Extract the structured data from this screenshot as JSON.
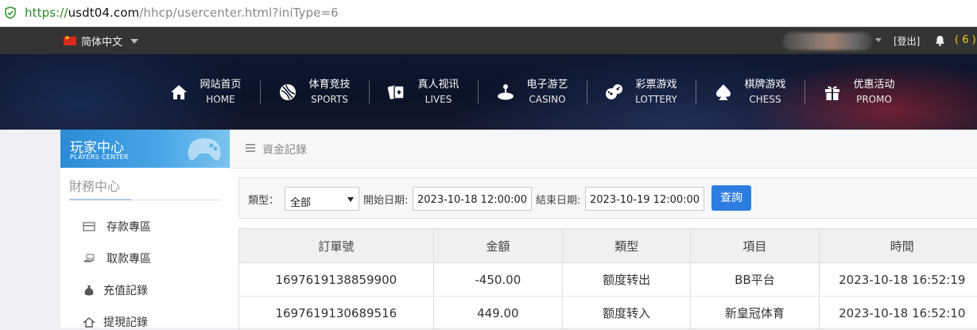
{
  "address_bar": {
    "scheme": "https://",
    "domain": "usdt04.com",
    "path": "/hhcp/usercenter.html?iniType=6"
  },
  "topbar": {
    "language": "简体中文",
    "logout": "[登出]",
    "notice_count": "( 6 )"
  },
  "nav": [
    {
      "cn": "网站首页",
      "en": "HOME",
      "icon": "home-icon"
    },
    {
      "cn": "体育竞技",
      "en": "SPORTS",
      "icon": "ball-icon"
    },
    {
      "cn": "真人视讯",
      "en": "LIVES",
      "icon": "cards-icon"
    },
    {
      "cn": "电子游艺",
      "en": "CASINO",
      "icon": "joystick-icon"
    },
    {
      "cn": "彩票游戏",
      "en": "LOTTERY",
      "icon": "dice-icon"
    },
    {
      "cn": "棋牌游戏",
      "en": "CHESS",
      "icon": "spade-icon"
    },
    {
      "cn": "优惠活动",
      "en": "PROMO",
      "icon": "gift-icon"
    }
  ],
  "sidebar": {
    "header_cn": "玩家中心",
    "header_en": "PLAYERS CENTER",
    "section_title": "財務中心",
    "items": [
      {
        "label": "存款專區",
        "icon": "deposit-card-icon"
      },
      {
        "label": "取款專區",
        "icon": "withdraw-hand-icon"
      },
      {
        "label": "充值記錄",
        "icon": "money-bag-icon"
      },
      {
        "label": "提現記錄",
        "icon": "withdraw-record-icon"
      }
    ]
  },
  "content": {
    "breadcrumb": "資金記錄",
    "filter": {
      "type_label": "類型：",
      "type_value": "全部",
      "start_label": "開始日期:",
      "start_value": "2023-10-18 12:00:00",
      "end_label": "結束日期:",
      "end_value": "2023-10-19 12:00:00",
      "query_button": "查詢"
    },
    "table": {
      "headers": [
        "訂單號",
        "金額",
        "類型",
        "項目",
        "時間"
      ],
      "rows": [
        [
          "1697619138859900",
          "-450.00",
          "额度转出",
          "BB平台",
          "2023-10-18 16:52:19"
        ],
        [
          "1697619130689516",
          "449.00",
          "额度转入",
          "新皇冠体育",
          "2023-10-18 16:52:10"
        ]
      ]
    }
  }
}
